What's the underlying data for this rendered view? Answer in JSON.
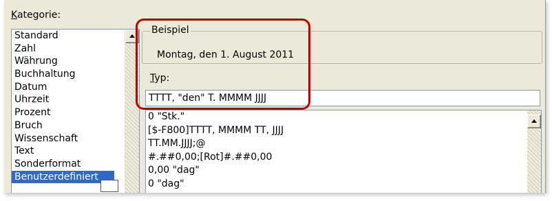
{
  "kategorie": {
    "label": "Kategorie:",
    "items": [
      "Standard",
      "Zahl",
      "Währung",
      "Buchhaltung",
      "Datum",
      "Uhrzeit",
      "Prozent",
      "Bruch",
      "Wissenschaft",
      "Text",
      "Sonderformat",
      "Benutzerdefiniert"
    ],
    "selected": "Benutzerdefiniert"
  },
  "beispiel": {
    "title": "Beispiel",
    "value": "Montag, den 1. August 2011"
  },
  "typ": {
    "label": "Typ:",
    "value": "TTTT, \"den\" T. MMMM JJJJ"
  },
  "format_list": {
    "items": [
      "0 \"Stk.\"",
      "[$-F800]TTTT, MMMM TT, JJJJ",
      "TT.MM.JJJJ;@",
      "#.##0,00;[Rot]#.##0,00",
      "0,00 \"dag\"",
      "0 \"dag\""
    ]
  },
  "colors": {
    "highlight": "#c00000",
    "selection": "#316ac5",
    "dialog_bg": "#ece9d8"
  }
}
